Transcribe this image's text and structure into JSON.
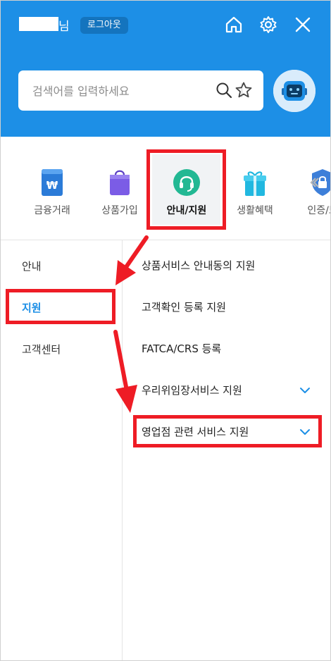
{
  "header": {
    "user_suffix": "님",
    "logout_label": "로그아웃",
    "icons": [
      "home-icon",
      "gear-icon",
      "close-icon"
    ]
  },
  "search": {
    "placeholder": "검색어를 입력하세요",
    "value": ""
  },
  "categories": [
    {
      "label": "금융거래",
      "icon": "wallet-won-icon"
    },
    {
      "label": "상품가입",
      "icon": "shopping-bag-icon"
    },
    {
      "label": "안내/지원",
      "icon": "headset-icon",
      "active": true
    },
    {
      "label": "생활혜택",
      "icon": "gift-icon"
    },
    {
      "label": "인증/보",
      "icon": "shield-lock-icon"
    }
  ],
  "left_menu": [
    {
      "label": "안내"
    },
    {
      "label": "지원",
      "active": true
    },
    {
      "label": "고객센터"
    }
  ],
  "right_menu": [
    {
      "label": "상품서비스 안내동의 지원"
    },
    {
      "label": "고객확인 등록 지원"
    },
    {
      "label": "FATCA/CRS 등록"
    },
    {
      "label": "우리위임장서비스 지원",
      "expandable": true
    },
    {
      "label": "영업점 관련 서비스 지원",
      "expandable": true
    }
  ],
  "colors": {
    "brand": "#1d8fe6",
    "annotation": "#ee1c25"
  }
}
